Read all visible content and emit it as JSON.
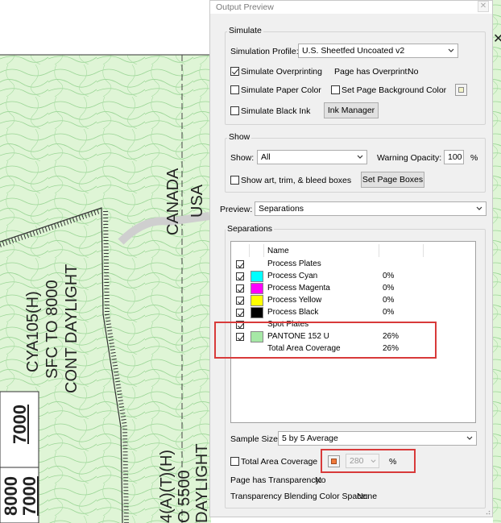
{
  "dialog": {
    "title": "Output Preview",
    "close_label": "x",
    "simulate": {
      "group_label": "Simulate",
      "profile_label": "Simulation Profile:",
      "profile_value": "U.S. Sheetfed Uncoated v2",
      "overprinting_label": "Simulate Overprinting",
      "overprinting_checked": true,
      "overprint_status_label": "Page has Overprint:",
      "overprint_status_value": "No",
      "paper_color_label": "Simulate Paper Color",
      "page_bg_label": "Set Page Background Color",
      "black_ink_label": "Simulate Black Ink",
      "ink_manager_label": "Ink Manager"
    },
    "show": {
      "group_label": "Show",
      "show_label": "Show:",
      "show_value": "All",
      "warning_opacity_label": "Warning Opacity:",
      "warning_opacity_value": "100",
      "warning_opacity_unit": "%",
      "show_boxes_label": "Show art, trim, & bleed boxes",
      "set_page_boxes_label": "Set Page Boxes"
    },
    "preview": {
      "label": "Preview:",
      "value": "Separations"
    },
    "separations": {
      "group_label": "Separations",
      "column_name": "Name",
      "rows": [
        {
          "name": "Process Plates",
          "checked": true,
          "swatch": "",
          "pct": ""
        },
        {
          "name": "Process Cyan",
          "checked": true,
          "swatch": "#00ffff",
          "pct": "0%"
        },
        {
          "name": "Process Magenta",
          "checked": true,
          "swatch": "#ff00ff",
          "pct": "0%"
        },
        {
          "name": "Process Yellow",
          "checked": true,
          "swatch": "#ffff00",
          "pct": "0%"
        },
        {
          "name": "Process Black",
          "checked": true,
          "swatch": "#000000",
          "pct": "0%"
        },
        {
          "name": "Spot Plates",
          "checked": true,
          "swatch": "",
          "pct": ""
        },
        {
          "name": "PANTONE 152 U",
          "checked": true,
          "swatch": "#a6e8a6",
          "pct": "26%"
        },
        {
          "name": "Total Area Coverage",
          "checked": false,
          "swatch": "",
          "pct": "26%"
        }
      ]
    },
    "sample_size": {
      "label": "Sample Size:",
      "value": "5 by 5 Average"
    },
    "total_area": {
      "label": "Total Area Coverage",
      "color": "#f07a3c",
      "value": "280",
      "unit": "%"
    },
    "transparency": {
      "label": "Page has Transparency:",
      "value": "No"
    },
    "blending": {
      "label": "Transparency Blending Color Space:",
      "value": "None"
    }
  },
  "map": {
    "canada": "CANADA",
    "usa": "USA",
    "cya_line1": "CYA105(H)",
    "cya_line2": "SFC TO 8000",
    "cya_line3": "CONT DAYLIGHT",
    "bottom_line1": "4(A)(T)(H)",
    "bottom_line2": "O 5500",
    "bottom_line3": "DAYLIGHT",
    "alt_top": "7000",
    "alt_bottom_a": "8000",
    "alt_bottom_b": "7000",
    "terrain_color": "#d9f2d0",
    "contour_color": "#8fd18a"
  },
  "colors": {
    "highlight": "#d83a3a"
  }
}
